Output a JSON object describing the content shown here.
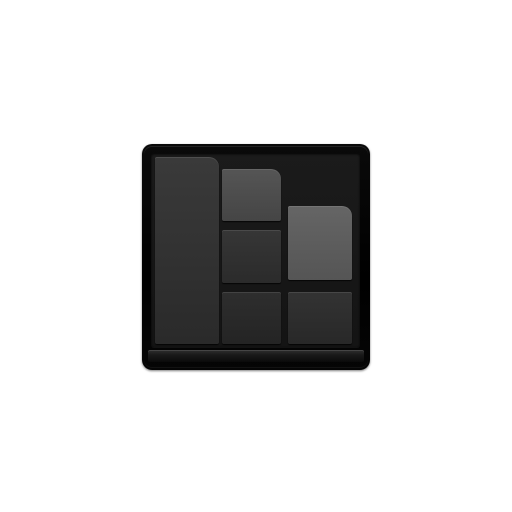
{
  "icon": {
    "name": "bar-chart-icon",
    "colors": {
      "frame": "#000000",
      "well": "#181818",
      "tile_dark": "#2a2a2a",
      "tile_mid": "#454545",
      "tile_light": "#5a5a5a"
    },
    "tiles": [
      {
        "name": "tile-tall",
        "shade": "#323232"
      },
      {
        "name": "tile-mid-top",
        "shade": "#4d4d4d"
      },
      {
        "name": "tile-mid-center",
        "shade": "#303030"
      },
      {
        "name": "tile-right-top",
        "shade": "#5d5d5d"
      },
      {
        "name": "tile-mid-bottom",
        "shade": "#292929"
      },
      {
        "name": "tile-right-bottom",
        "shade": "#2d2d2d"
      }
    ]
  }
}
